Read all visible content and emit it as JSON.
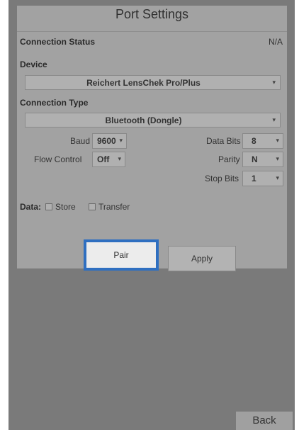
{
  "title": "Port Settings",
  "connection_status": {
    "label": "Connection Status",
    "value": "N/A"
  },
  "device": {
    "label": "Device",
    "selected": "Reichert LensChek Pro/Plus"
  },
  "connection_type": {
    "label": "Connection Type",
    "selected": "Bluetooth (Dongle)"
  },
  "serial": {
    "baud": {
      "label": "Baud",
      "value": "9600"
    },
    "flow_control": {
      "label": "Flow Control",
      "value": "Off"
    },
    "data_bits": {
      "label": "Data Bits",
      "value": "8"
    },
    "parity": {
      "label": "Parity",
      "value": "N"
    },
    "stop_bits": {
      "label": "Stop Bits",
      "value": "1"
    }
  },
  "data_options": {
    "label": "Data:",
    "store": "Store",
    "transfer": "Transfer"
  },
  "buttons": {
    "pair": "Pair",
    "apply": "Apply",
    "back": "Back"
  },
  "icons": {
    "dropdown": "▾"
  },
  "colors": {
    "focus_border": "#2f6fc0"
  }
}
